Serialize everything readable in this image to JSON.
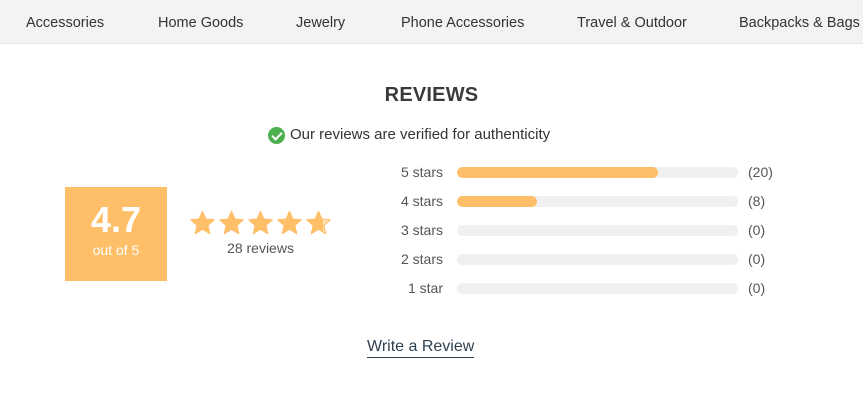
{
  "nav": {
    "items": [
      {
        "label": "Accessories"
      },
      {
        "label": "Home Goods"
      },
      {
        "label": "Jewelry"
      },
      {
        "label": "Phone Accessories"
      },
      {
        "label": "Travel & Outdoor"
      },
      {
        "label": "Backpacks & Bags"
      }
    ]
  },
  "reviews": {
    "title": "REVIEWS",
    "verified_text": "Our reviews are verified for authenticity",
    "verified_icon": "check-circle-icon",
    "score": "4.7",
    "score_sub": "out of 5",
    "rating": 4.7,
    "max_rating": 5,
    "review_count_text": "28 reviews",
    "distribution": [
      {
        "label": "5 stars",
        "count_text": "(20)",
        "count": 20
      },
      {
        "label": "4 stars",
        "count_text": "(8)",
        "count": 8
      },
      {
        "label": "3 stars",
        "count_text": "(0)",
        "count": 0
      },
      {
        "label": "2 stars",
        "count_text": "(0)",
        "count": 0
      },
      {
        "label": "1 star",
        "count_text": "(0)",
        "count": 0
      }
    ],
    "write_review_label": "Write a Review"
  },
  "colors": {
    "accent": "#ffbf69",
    "track": "#f0f0f0",
    "verified": "#4caf50",
    "nav_bg": "#f3f3f3",
    "link": "#2f4150"
  }
}
